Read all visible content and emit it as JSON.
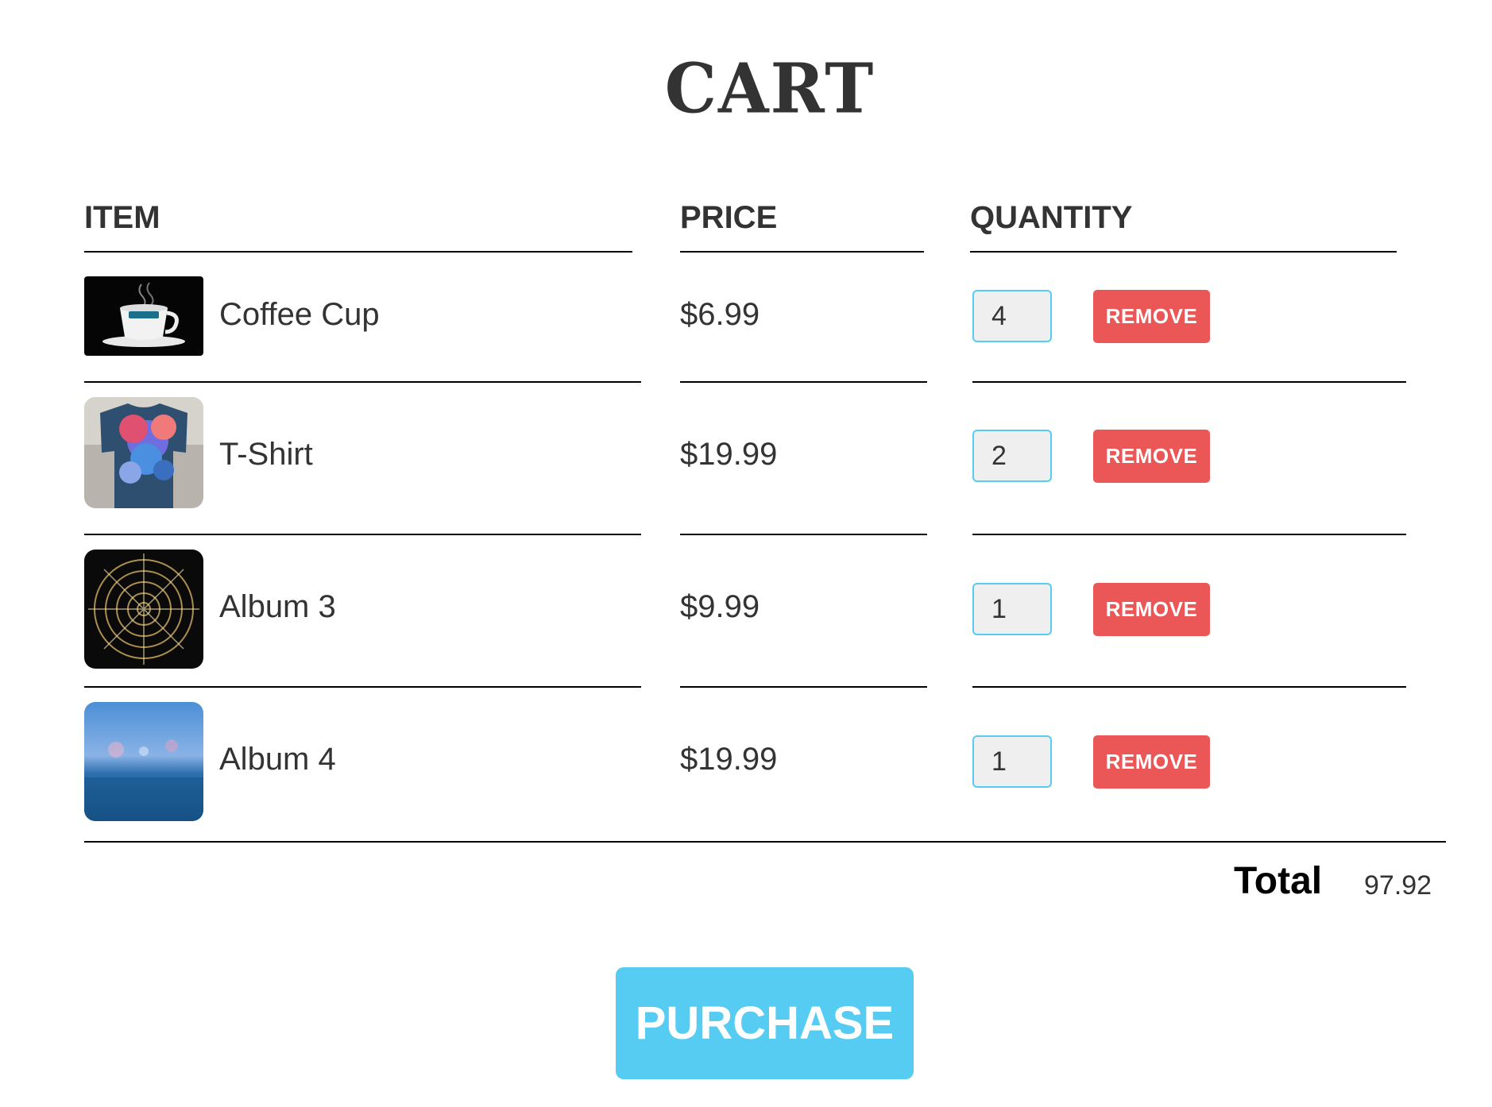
{
  "cart": {
    "title": "CART",
    "headers": {
      "item": "ITEM",
      "price": "PRICE",
      "quantity": "QUANTITY"
    },
    "items": [
      {
        "name": "Coffee Cup",
        "price": "$6.99",
        "quantity": "4",
        "image": "coffee-cup-image",
        "remove_label": "REMOVE"
      },
      {
        "name": "T-Shirt",
        "price": "$19.99",
        "quantity": "2",
        "image": "t-shirt-image",
        "remove_label": "REMOVE"
      },
      {
        "name": "Album 3",
        "price": "$9.99",
        "quantity": "1",
        "image": "album-3-image",
        "remove_label": "REMOVE"
      },
      {
        "name": "Album 4",
        "price": "$19.99",
        "quantity": "1",
        "image": "album-4-image",
        "remove_label": "REMOVE"
      }
    ],
    "total_label": "Total",
    "total_value": "97.92",
    "purchase_label": "PURCHASE"
  },
  "colors": {
    "accent": "#56ccf2",
    "remove": "#eb5757",
    "text": "#333333"
  }
}
